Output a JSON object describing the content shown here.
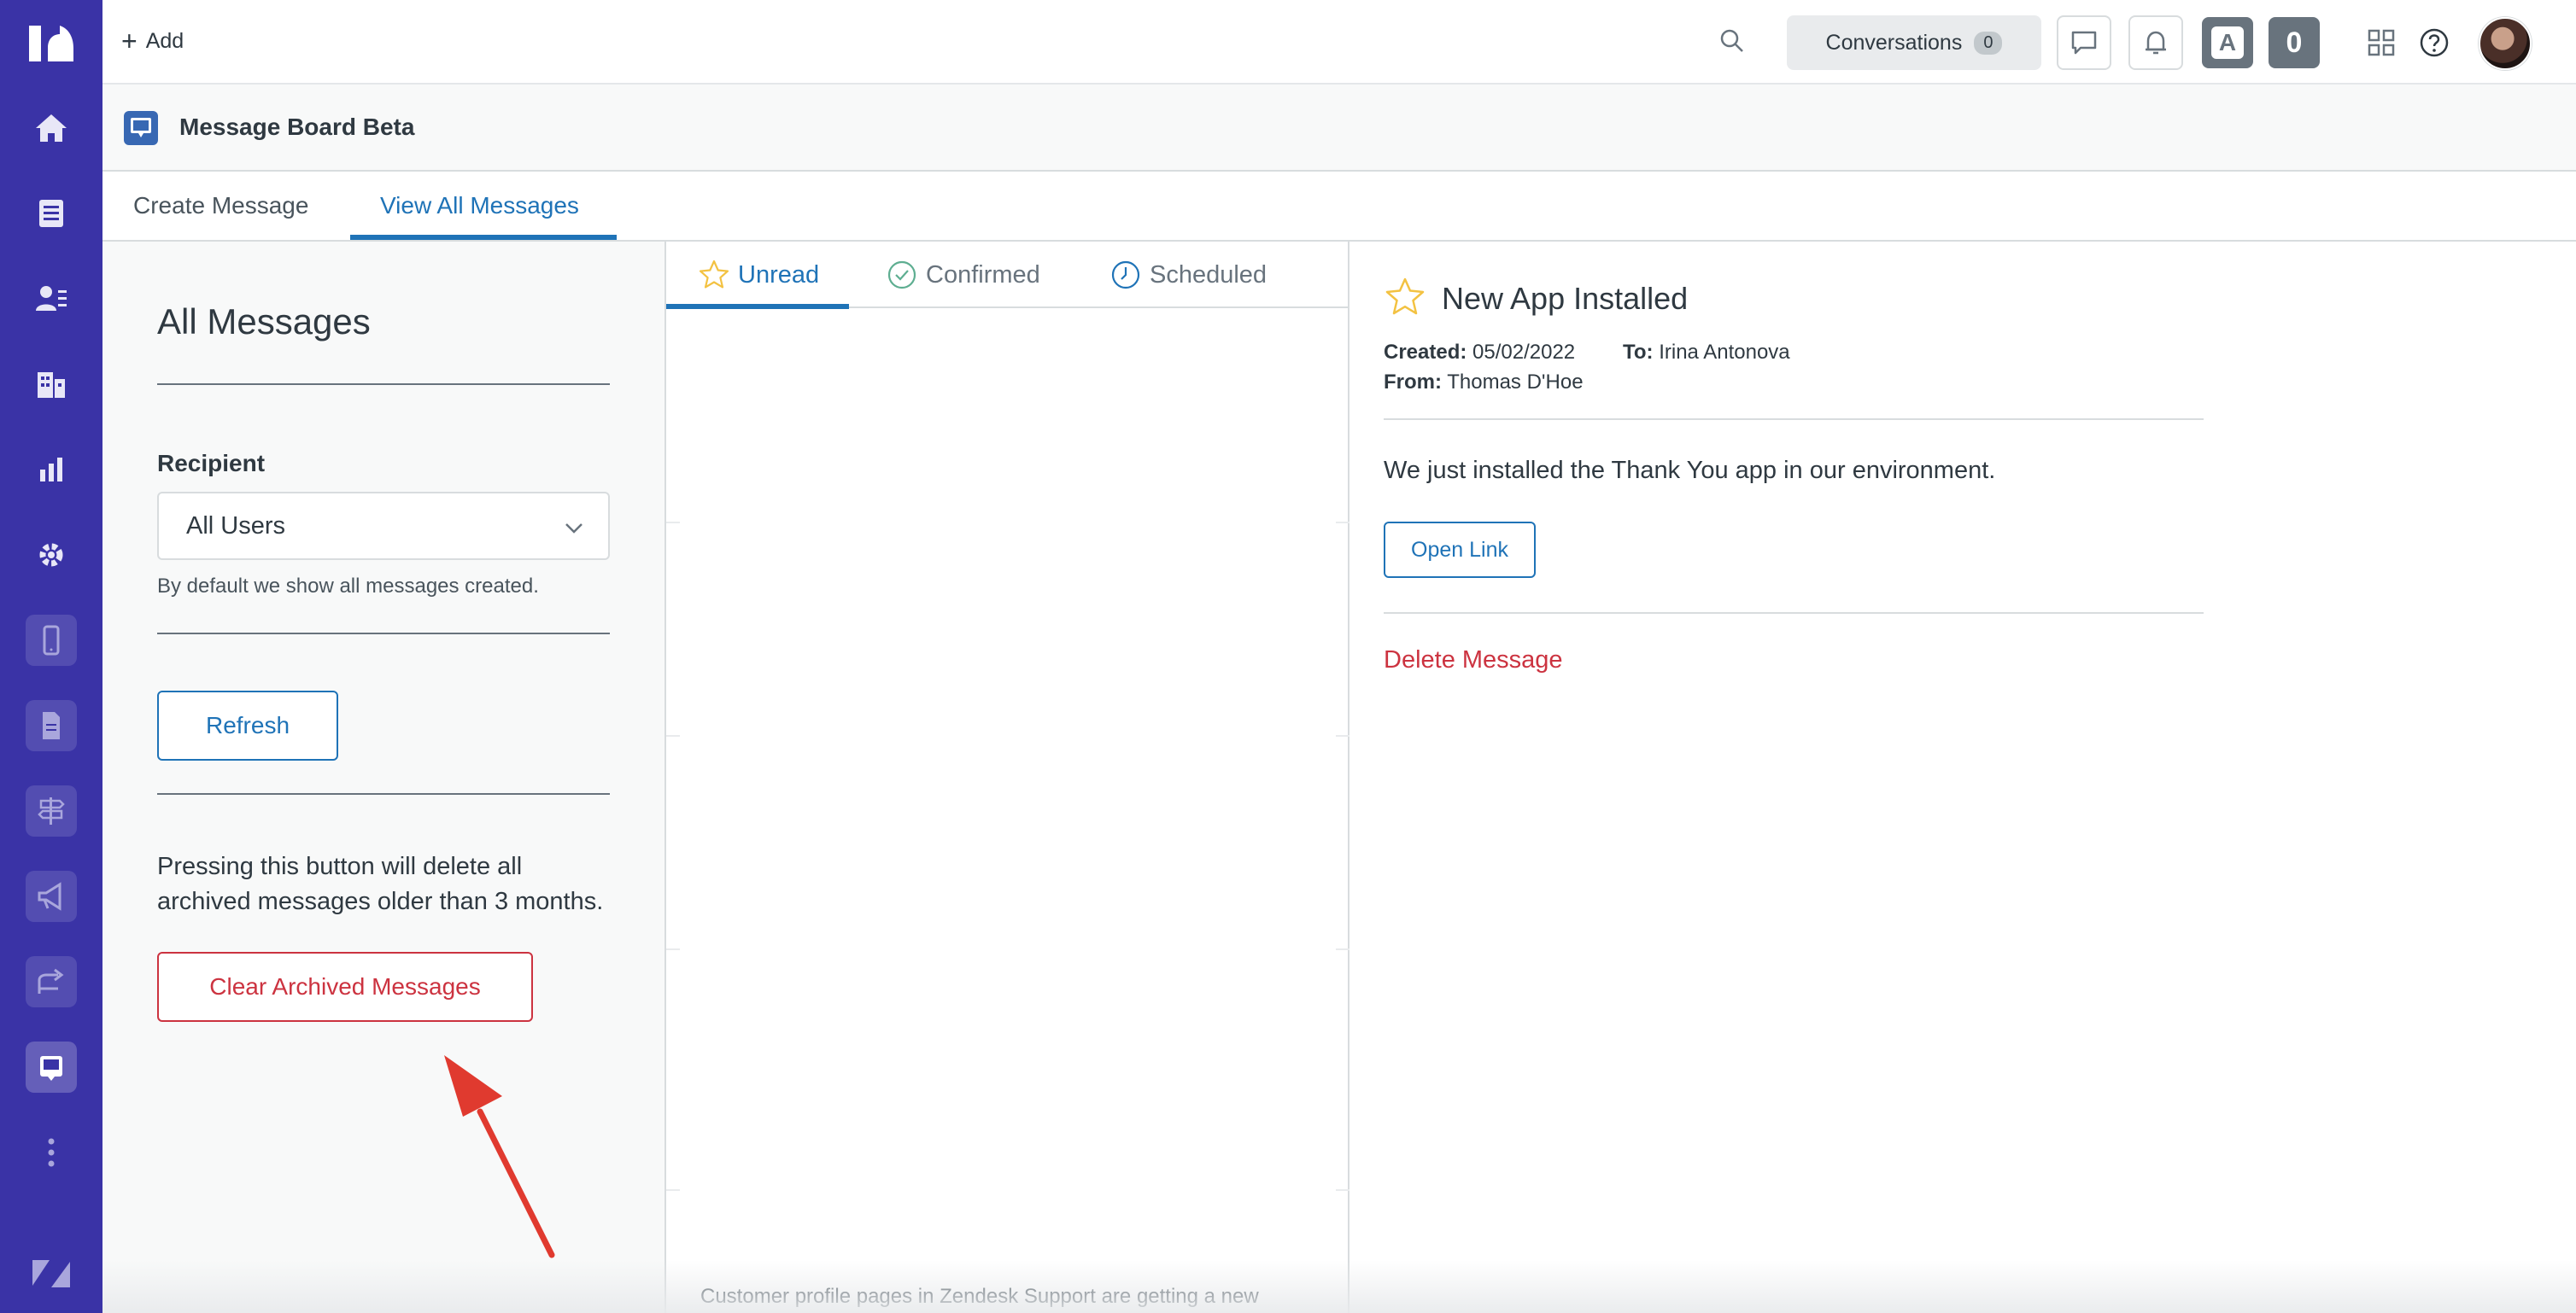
{
  "topbar": {
    "add_label": "Add",
    "conversations_label": "Conversations",
    "conversations_count": "0",
    "agent_badge": "A",
    "count_badge": "0"
  },
  "app": {
    "title": "Message Board Beta"
  },
  "tabs": {
    "create": "Create Message",
    "view_all": "View All Messages"
  },
  "filters": {
    "title": "All Messages",
    "recipient_label": "Recipient",
    "recipient_value": "All Users",
    "recipient_hint": "By default we show all messages created.",
    "refresh_label": "Refresh",
    "warning_text": "Pressing this button will delete all archived messages older than 3 months.",
    "clear_label": "Clear Archived Messages"
  },
  "list": {
    "tabs": [
      "Unread",
      "Confirmed",
      "Scheduled"
    ],
    "footer_text": "Customer profile pages in Zendesk Support are getting a new"
  },
  "detail": {
    "title": "New App Installed",
    "created_label": "Created:",
    "created_value": "05/02/2022",
    "to_label": "To:",
    "to_value": "Irina Antonova",
    "from_label": "From:",
    "from_value": "Thomas D'Hoe",
    "body": "We just installed the Thank You app in our environment.",
    "open_link_label": "Open Link",
    "delete_label": "Delete Message"
  },
  "colors": {
    "rail": "#3a33a6",
    "accent_blue": "#1f73b7",
    "danger_red": "#cc3340",
    "arrow_red": "#e03a2f"
  }
}
